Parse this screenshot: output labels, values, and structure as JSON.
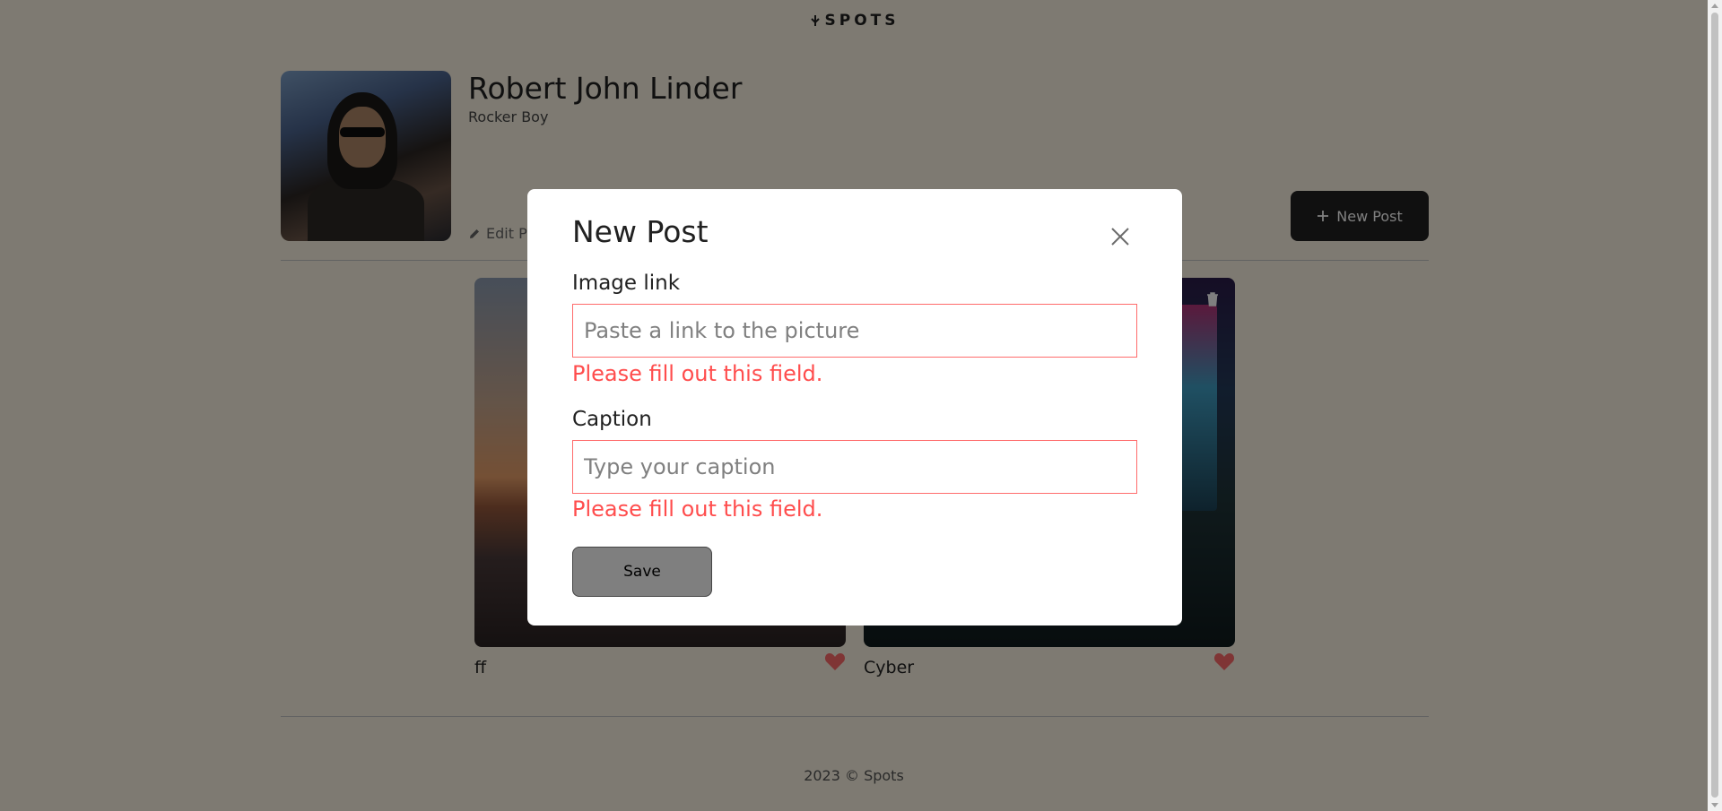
{
  "header": {
    "logo_text": "SPOTS"
  },
  "profile": {
    "name": "Robert John Linder",
    "job": "Rocker Boy",
    "edit_label": "Edit Profile",
    "new_post_label": "New Post"
  },
  "cards": [
    {
      "title": "ff",
      "liked": true
    },
    {
      "title": "Cyber",
      "liked": true
    }
  ],
  "footer": {
    "text": "2023 © Spots"
  },
  "modal": {
    "title": "New Post",
    "image_link_label": "Image link",
    "image_link_placeholder": "Paste a link to the picture",
    "image_link_value": "",
    "image_link_error": "Please fill out this field.",
    "caption_label": "Caption",
    "caption_placeholder": "Type your caption",
    "caption_value": "",
    "caption_error": "Please fill out this field.",
    "save_label": "Save",
    "save_disabled": true
  },
  "colors": {
    "page_background": "#fcf5e5",
    "text": "#212121",
    "error": "#ff4d4d",
    "heart": "#ff6b6b",
    "overlay": "rgba(0,0,0,0.5)"
  },
  "icons": {
    "logo": "spots-logo-icon",
    "edit": "pencil-icon",
    "new_post": "plus-icon",
    "close": "close-icon",
    "like": "heart-icon",
    "delete": "trash-icon"
  }
}
